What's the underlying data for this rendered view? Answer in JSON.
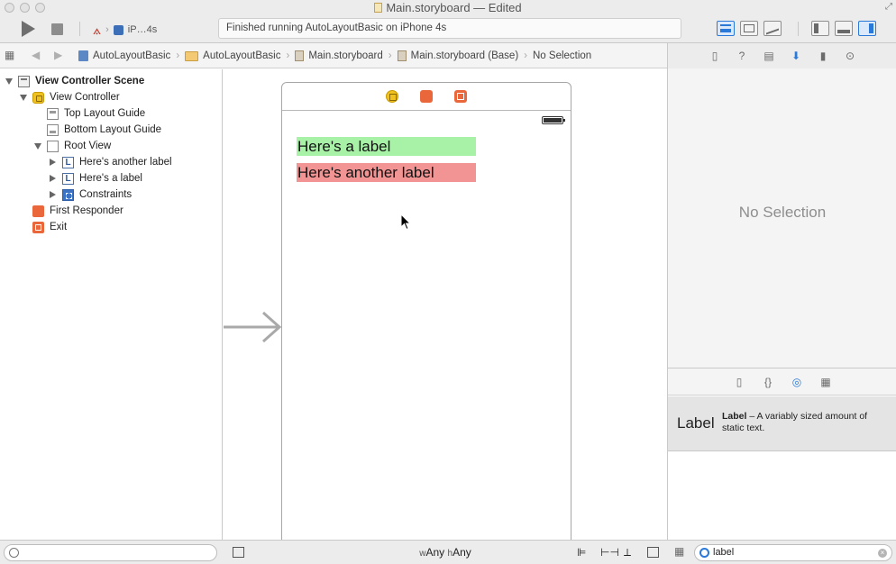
{
  "window": {
    "title": "Main.storyboard — Edited"
  },
  "toolbar": {
    "scheme_device": "iP…4s",
    "activity_status": "Finished running AutoLayoutBasic on iPhone 4s"
  },
  "jumpbar": {
    "crumbs": [
      {
        "label": "AutoLayoutBasic",
        "icon": "project-icon"
      },
      {
        "label": "AutoLayoutBasic",
        "icon": "folder-icon"
      },
      {
        "label": "Main.storyboard",
        "icon": "storyboard-file-icon"
      },
      {
        "label": "Main.storyboard (Base)",
        "icon": "storyboard-file-icon"
      },
      {
        "label": "No Selection",
        "icon": ""
      }
    ]
  },
  "outline": {
    "items": [
      {
        "label": "View Controller Scene",
        "level": 0,
        "expanded": true,
        "icon": "scene-icon"
      },
      {
        "label": "View Controller",
        "level": 1,
        "expanded": true,
        "icon": "view-controller-icon"
      },
      {
        "label": "Top Layout Guide",
        "level": 2,
        "icon": "layout-guide-icon"
      },
      {
        "label": "Bottom Layout Guide",
        "level": 2,
        "icon": "layout-guide-icon"
      },
      {
        "label": "Root View",
        "level": 2,
        "expanded": true,
        "icon": "view-icon"
      },
      {
        "label": "Here's another label",
        "level": 3,
        "expanded": false,
        "icon": "label-icon"
      },
      {
        "label": "Here's a label",
        "level": 3,
        "expanded": false,
        "icon": "label-icon"
      },
      {
        "label": "Constraints",
        "level": 3,
        "expanded": false,
        "icon": "constraints-icon"
      },
      {
        "label": "First Responder",
        "level": 1,
        "icon": "first-responder-icon"
      },
      {
        "label": "Exit",
        "level": 1,
        "icon": "exit-icon"
      }
    ]
  },
  "canvas": {
    "labels": [
      {
        "text": "Here's a label",
        "color": "#a8f2a8"
      },
      {
        "text": "Here's another label",
        "color": "#f39494"
      }
    ],
    "size_class_w_prefix": "w",
    "size_class_w": "Any",
    "size_class_h_prefix": "h",
    "size_class_h": "Any"
  },
  "inspector": {
    "empty_text": "No Selection"
  },
  "library": {
    "item_title": "Label",
    "item_name": "Label",
    "item_description": " – A variably sized amount of static text.",
    "search_value": "label"
  },
  "colors": {
    "accent": "#2a79d8",
    "label_green": "#a8f2a8",
    "label_red": "#f39494"
  }
}
